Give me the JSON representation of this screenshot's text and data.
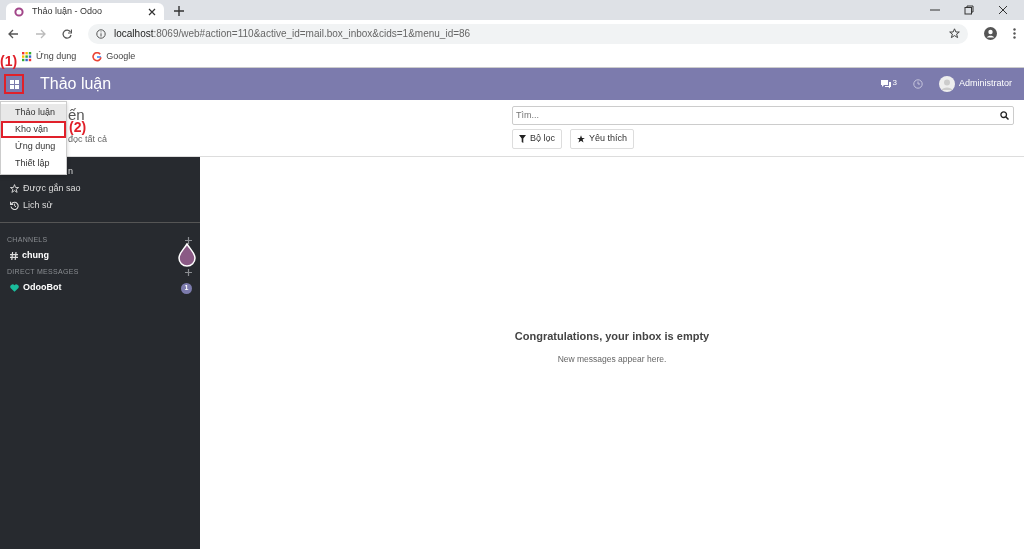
{
  "browser": {
    "tab": {
      "title": "Thảo luận - Odoo"
    },
    "address": {
      "host": "localhost",
      "path": ":8069/web#action=110&active_id=mail.box_inbox&cids=1&menu_id=86"
    },
    "bookmarks": [
      {
        "label": "Ứng dụng",
        "kind": "apps"
      },
      {
        "label": "Google",
        "kind": "google"
      }
    ]
  },
  "navbar": {
    "app_title": "Thảo luận",
    "apps_marked": true,
    "messages_count": "3",
    "user": "Administrator"
  },
  "apps_menu": {
    "items": [
      {
        "label": "Thảo luận",
        "selected": true,
        "marked": false
      },
      {
        "label": "Kho vận",
        "selected": false,
        "marked": true
      },
      {
        "label": "Ứng dụng",
        "selected": false,
        "marked": false
      },
      {
        "label": "Thiết lập",
        "selected": false,
        "marked": false
      }
    ]
  },
  "control_panel": {
    "title": "ến",
    "action": "đọc tất cả",
    "search": {
      "placeholder": "Tìm..."
    },
    "buttons": [
      {
        "label": "Bộ lọc",
        "kind": "filter"
      },
      {
        "label": "Yêu thích",
        "kind": "favorite"
      }
    ]
  },
  "sidebar": {
    "mailboxes": [
      {
        "label": "n",
        "kind": "inbox"
      },
      {
        "label": "Được gắn sao",
        "kind": "starred"
      },
      {
        "label": "Lịch sử",
        "kind": "history"
      }
    ],
    "sections": [
      {
        "title": "CHANNELS",
        "items": [
          {
            "label": "chung",
            "kind": "channel"
          }
        ]
      },
      {
        "title": "DIRECT MESSAGES",
        "items": [
          {
            "label": "OdooBot",
            "kind": "chat",
            "badge": "1"
          }
        ]
      }
    ]
  },
  "empty_state": {
    "title": "Congratulations, your inbox is empty",
    "subtitle": "New messages appear here."
  },
  "annotations": [
    {
      "label": "(1)"
    },
    {
      "label": "(2)"
    }
  ]
}
